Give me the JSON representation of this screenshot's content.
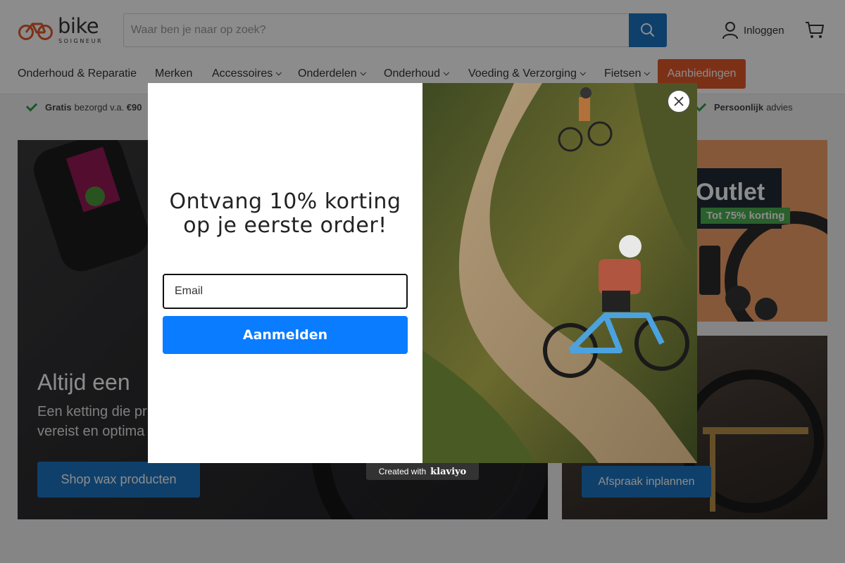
{
  "header": {
    "logo_word": "bike",
    "logo_sub": "SOIGNEUR",
    "search_placeholder": "Waar ben je naar op zoek?",
    "login_label": "Inloggen"
  },
  "nav": {
    "items": [
      {
        "label": "Onderhoud & Reparatie",
        "dropdown": false
      },
      {
        "label": "Merken",
        "dropdown": false
      },
      {
        "label": "Accessoires",
        "dropdown": true
      },
      {
        "label": "Onderdelen",
        "dropdown": true
      },
      {
        "label": "Onderhoud",
        "dropdown": true
      },
      {
        "label": "Voeding & Verzorging",
        "dropdown": true
      },
      {
        "label": "Fietsen",
        "dropdown": true
      }
    ],
    "deals_label": "Aanbiedingen"
  },
  "usp": {
    "item1_bold": "Gratis",
    "item1_text": "bezorgd v.a.",
    "item1_amount": "€90",
    "item2_bold": "Persoonlijk",
    "item2_text": "advies"
  },
  "hero": {
    "title": "Altijd een",
    "desc_line1": "Een ketting die pr",
    "desc_line2": "vereist en optima",
    "button_label": "Shop wax producten"
  },
  "outlet": {
    "title": "Outlet",
    "badge": "Tot 75% korting"
  },
  "service": {
    "button_label": "Afspraak inplannen"
  },
  "popup": {
    "heading_line1": "Ontvang 10% korting",
    "heading_line2": "op je eerste order!",
    "email_placeholder": "Email",
    "signup_label": "Aanmelden",
    "created_with": "Created with",
    "brand": "klaviyo"
  },
  "colors": {
    "primary_blue": "#1d75c4",
    "popup_button": "#0a7cff",
    "deals_orange": "#e2592b",
    "usp_check": "#2e9e48"
  }
}
